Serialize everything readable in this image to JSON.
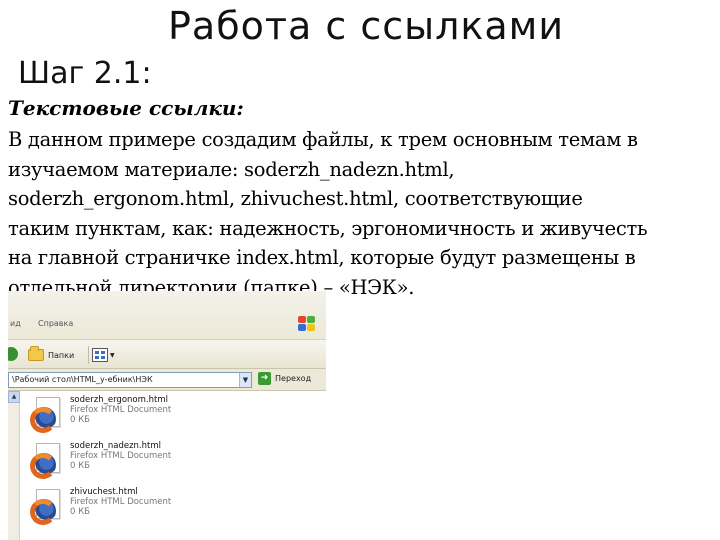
{
  "slide": {
    "title": "Работа с ссылками",
    "step": "Шаг 2.1:",
    "subheading": "Текстовые ссылки:",
    "body_lines": [
      "В данном примере создадим файлы, к трем основным темам в",
      "изучаемом материале: soderzh_nadezn.html,",
      "soderzh_ergonom.html, zhivuchest.html, соответствующие",
      "таким пунктам, как: надежность, эргономичность и живучесть",
      "на главной страничке index.html, которые будут размещены в",
      "отдельной директории (папке) – «НЭК»."
    ]
  },
  "explorer": {
    "menu": {
      "edit_partial": "ид",
      "help": "Справка"
    },
    "toolbar": {
      "folders_label": "Папки"
    },
    "address": {
      "path": "\\Рабочий стол\\HTML_у-ебник\\НЭК",
      "go_label": "Переход"
    },
    "files": [
      {
        "name": "soderzh_ergonom.html",
        "type": "Firefox HTML Document",
        "size": "0 КБ"
      },
      {
        "name": "soderzh_nadezn.html",
        "type": "Firefox HTML Document",
        "size": "0 КБ"
      },
      {
        "name": "zhivuchest.html",
        "type": "Firefox HTML Document",
        "size": "0 КБ"
      }
    ]
  },
  "colors": {
    "xp_bar": "#ece9d8",
    "address_border": "#7f9db9",
    "firefox_orange": "#e0661c"
  }
}
